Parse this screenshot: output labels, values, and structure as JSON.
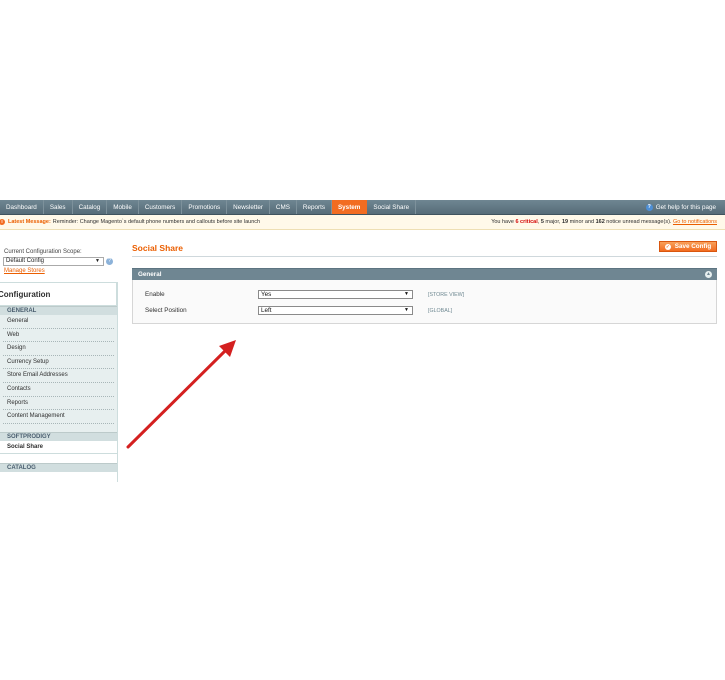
{
  "nav": {
    "items": [
      "Dashboard",
      "Sales",
      "Catalog",
      "Mobile",
      "Customers",
      "Promotions",
      "Newsletter",
      "CMS",
      "Reports",
      "System",
      "Social Share"
    ],
    "active": "System",
    "help": "Get help for this page"
  },
  "message": {
    "label": "Latest Message:",
    "text": "Reminder: Change Magento`s default phone numbers and callouts before site launch",
    "summary_prefix": "You have ",
    "critical": "6 critical",
    "sep1": ", ",
    "major": "5",
    "major_label": " major, ",
    "minor": "19",
    "minor_label": " minor and ",
    "notice": "162",
    "notice_label": " notice unread message(s). ",
    "link": "Go to notifications"
  },
  "sidebar": {
    "scope_label": "Current Configuration Scope:",
    "scope_value": "Default Config",
    "manage_stores": "Manage Stores",
    "heading": "Configuration",
    "general_section": "GENERAL",
    "general_items": [
      "General",
      "Web",
      "Design",
      "Currency Setup",
      "Store Email Addresses",
      "Contacts",
      "Reports",
      "Content Management"
    ],
    "softprodigy_section": "SOFTPRODIGY",
    "softprodigy_items": [
      "Social Share"
    ],
    "catalog_section": "CATALOG"
  },
  "main": {
    "title": "Social Share",
    "save_label": "Save Config",
    "fieldset_title": "General",
    "fields": [
      {
        "label": "Enable",
        "value": "Yes",
        "scope": "[STORE VIEW]"
      },
      {
        "label": "Select Position",
        "value": "Left",
        "scope": "[GLOBAL]"
      }
    ]
  },
  "colors": {
    "accent": "#f26c21",
    "nav_bg": "#6f8692",
    "arrow": "#d42020"
  }
}
